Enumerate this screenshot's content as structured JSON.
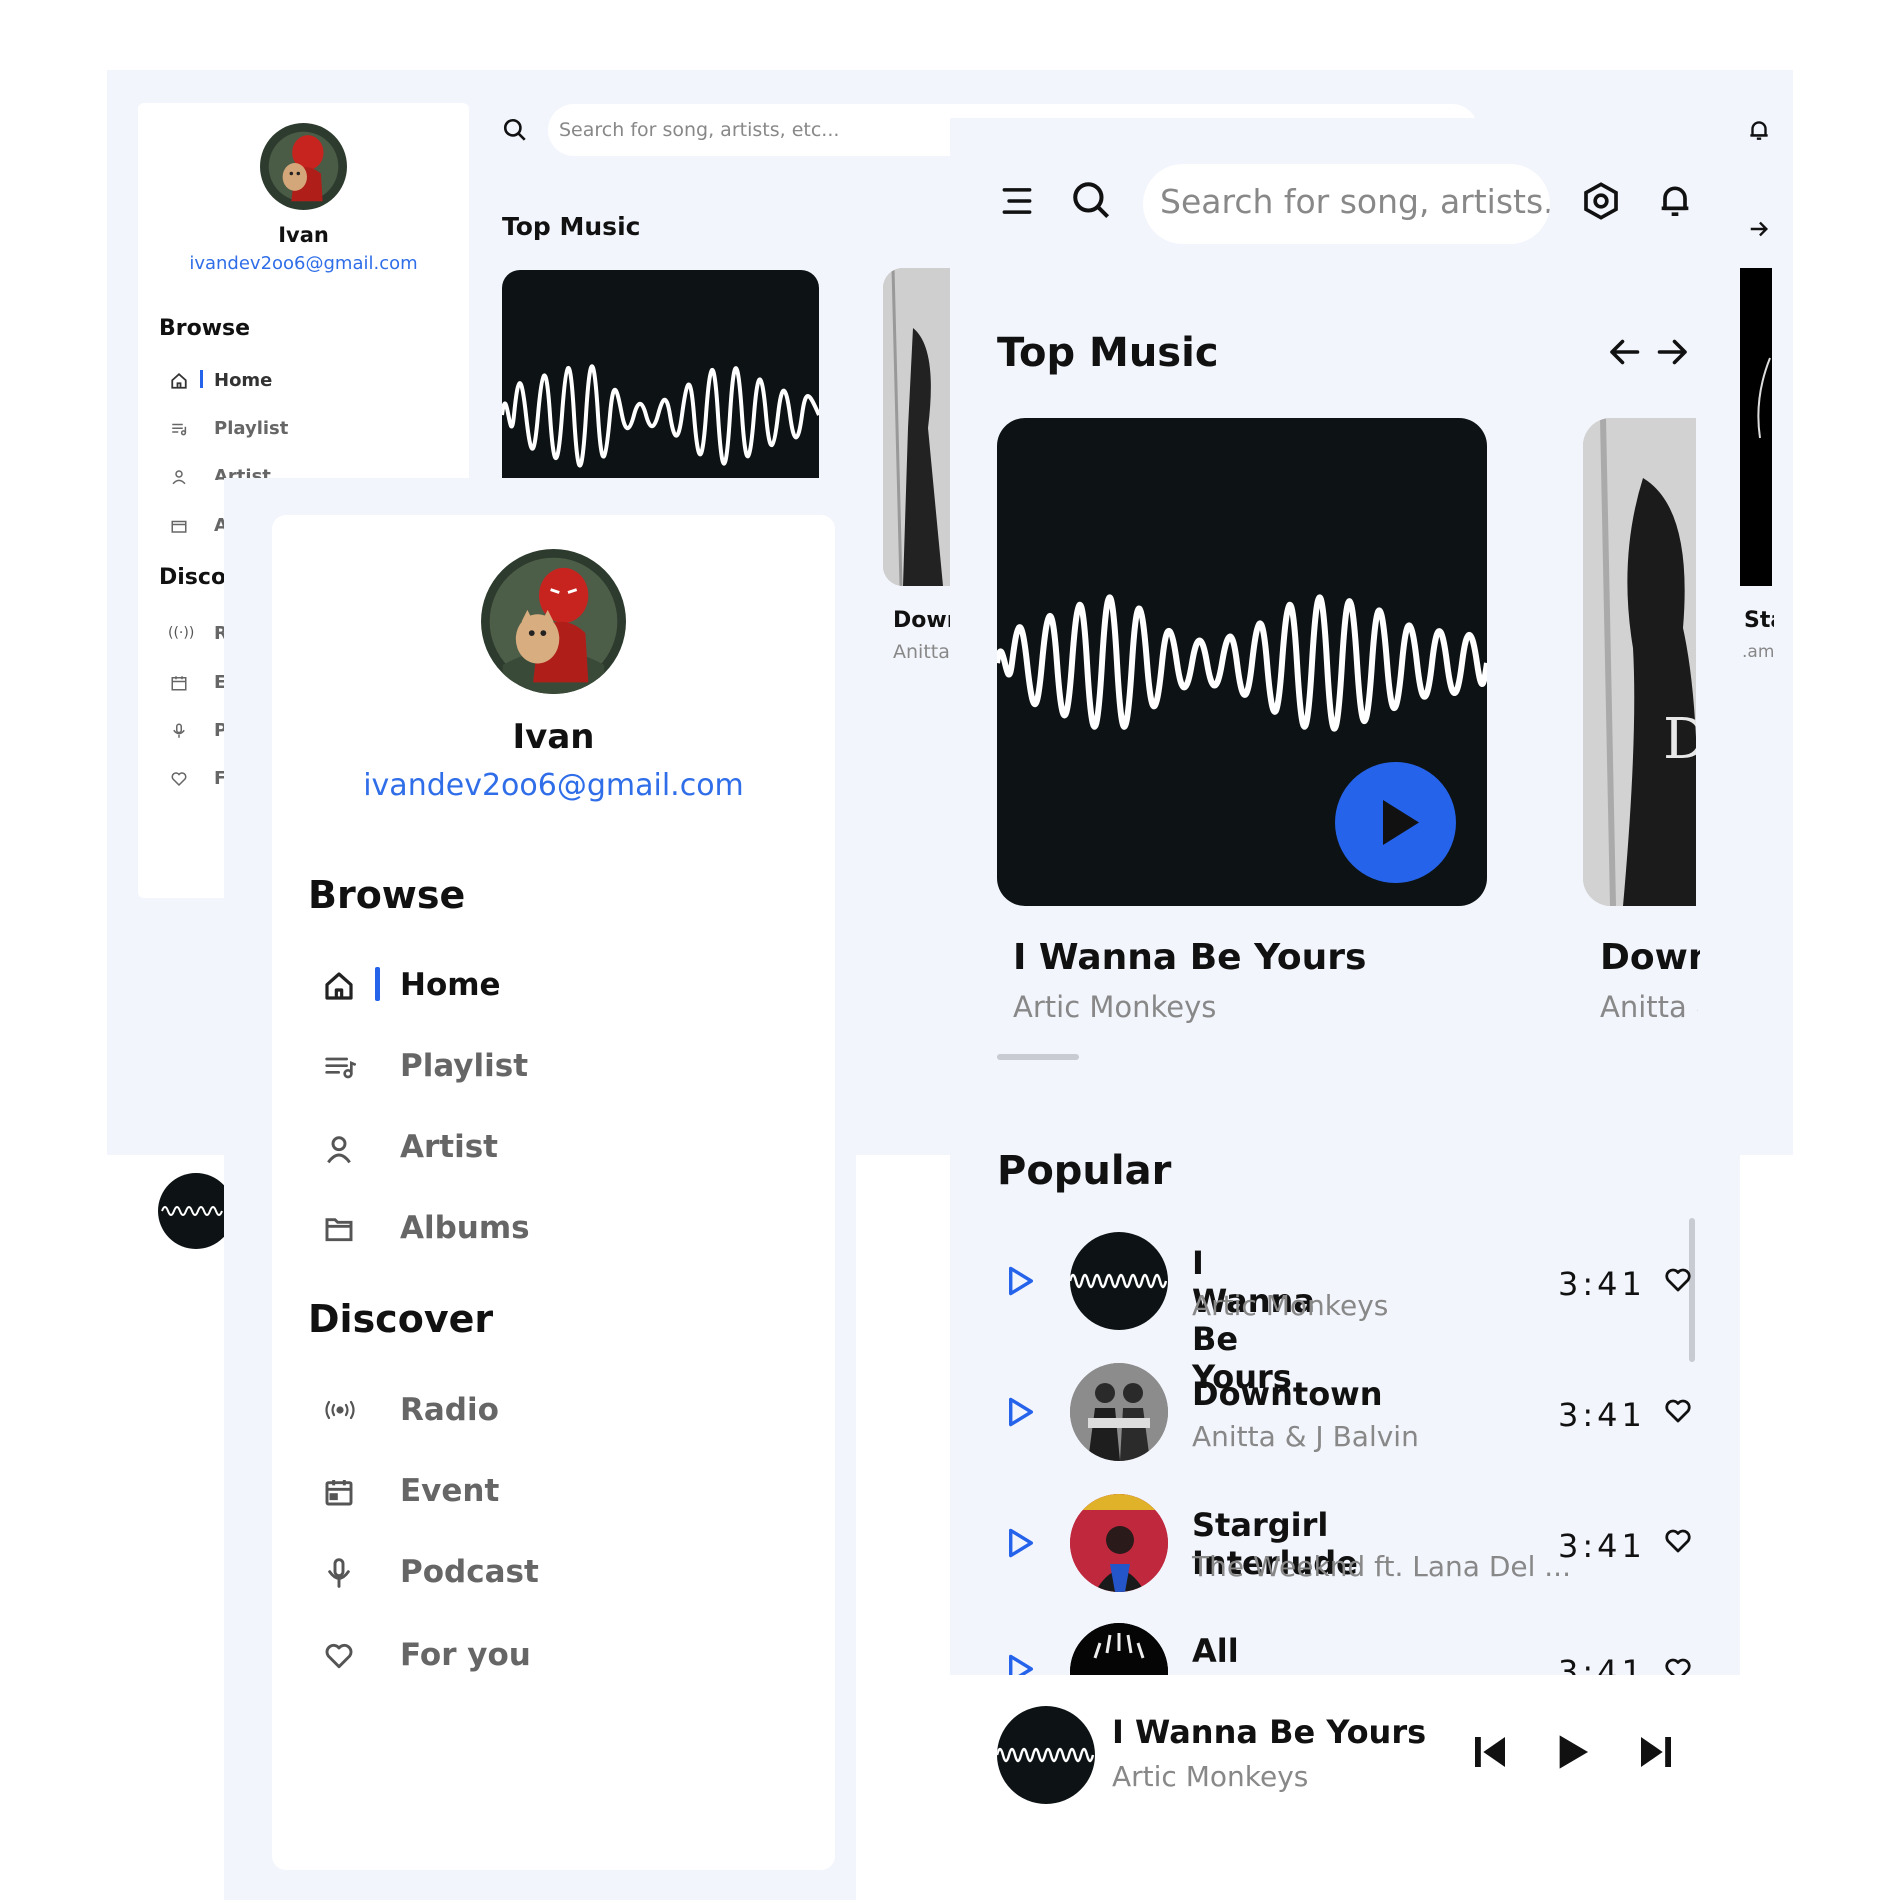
{
  "user": {
    "name": "Ivan",
    "email": "ivandev2oo6@gmail.com"
  },
  "nav": {
    "browse_heading": "Browse",
    "browse": [
      {
        "label": "Home",
        "icon": "home-icon",
        "active": true
      },
      {
        "label": "Playlist",
        "icon": "playlist-icon"
      },
      {
        "label": "Artist",
        "icon": "artist-icon"
      },
      {
        "label": "Albums",
        "icon": "albums-icon"
      }
    ],
    "discover_heading": "Discover",
    "discover": [
      {
        "label": "Radio",
        "icon": "radio-icon"
      },
      {
        "label": "Event",
        "icon": "calendar-icon"
      },
      {
        "label": "Podcast",
        "icon": "microphone-icon"
      },
      {
        "label": "For you",
        "icon": "heart-icon"
      }
    ]
  },
  "desktop": {
    "search_placeholder": "Search for song, artists, etc...",
    "section_title": "Top Music",
    "partial_song": "Dowr",
    "partial_artist": "Anitta",
    "edge_song": "Sta",
    "edge_artist": ".am",
    "partial_nav": {
      "artist": "Artist",
      "albums": "A",
      "discover": "Disco",
      "radio": "R",
      "event": "E",
      "podcast": "P",
      "foryou": "F"
    }
  },
  "mobile": {
    "search_placeholder": "Search for song, artists...",
    "top_music_title": "Top Music",
    "featured": {
      "title": "I Wanna Be Yours",
      "artist": "Artic Monkeys"
    },
    "next_featured": {
      "title": "Down",
      "artist": "Anitta &"
    },
    "popular_title": "Popular",
    "popular": [
      {
        "title": "I Wanna Be Yours",
        "artist": "Artic Monkeys",
        "time": "3:41"
      },
      {
        "title": "Downtown",
        "artist": "Anitta & J Balvin",
        "time": "3:41"
      },
      {
        "title": "Stargirl Interlude",
        "artist": "The Weeknd ft. Lana Del ...",
        "time": "3:41"
      },
      {
        "title": "All The Stars",
        "artist": "",
        "time": "3:41"
      }
    ],
    "now_playing": {
      "title": "I Wanna Be Yours",
      "artist": "Artic Monkeys"
    }
  },
  "colors": {
    "accent": "#2563eb",
    "background": "#f2f5fc",
    "card": "#0d1314"
  }
}
